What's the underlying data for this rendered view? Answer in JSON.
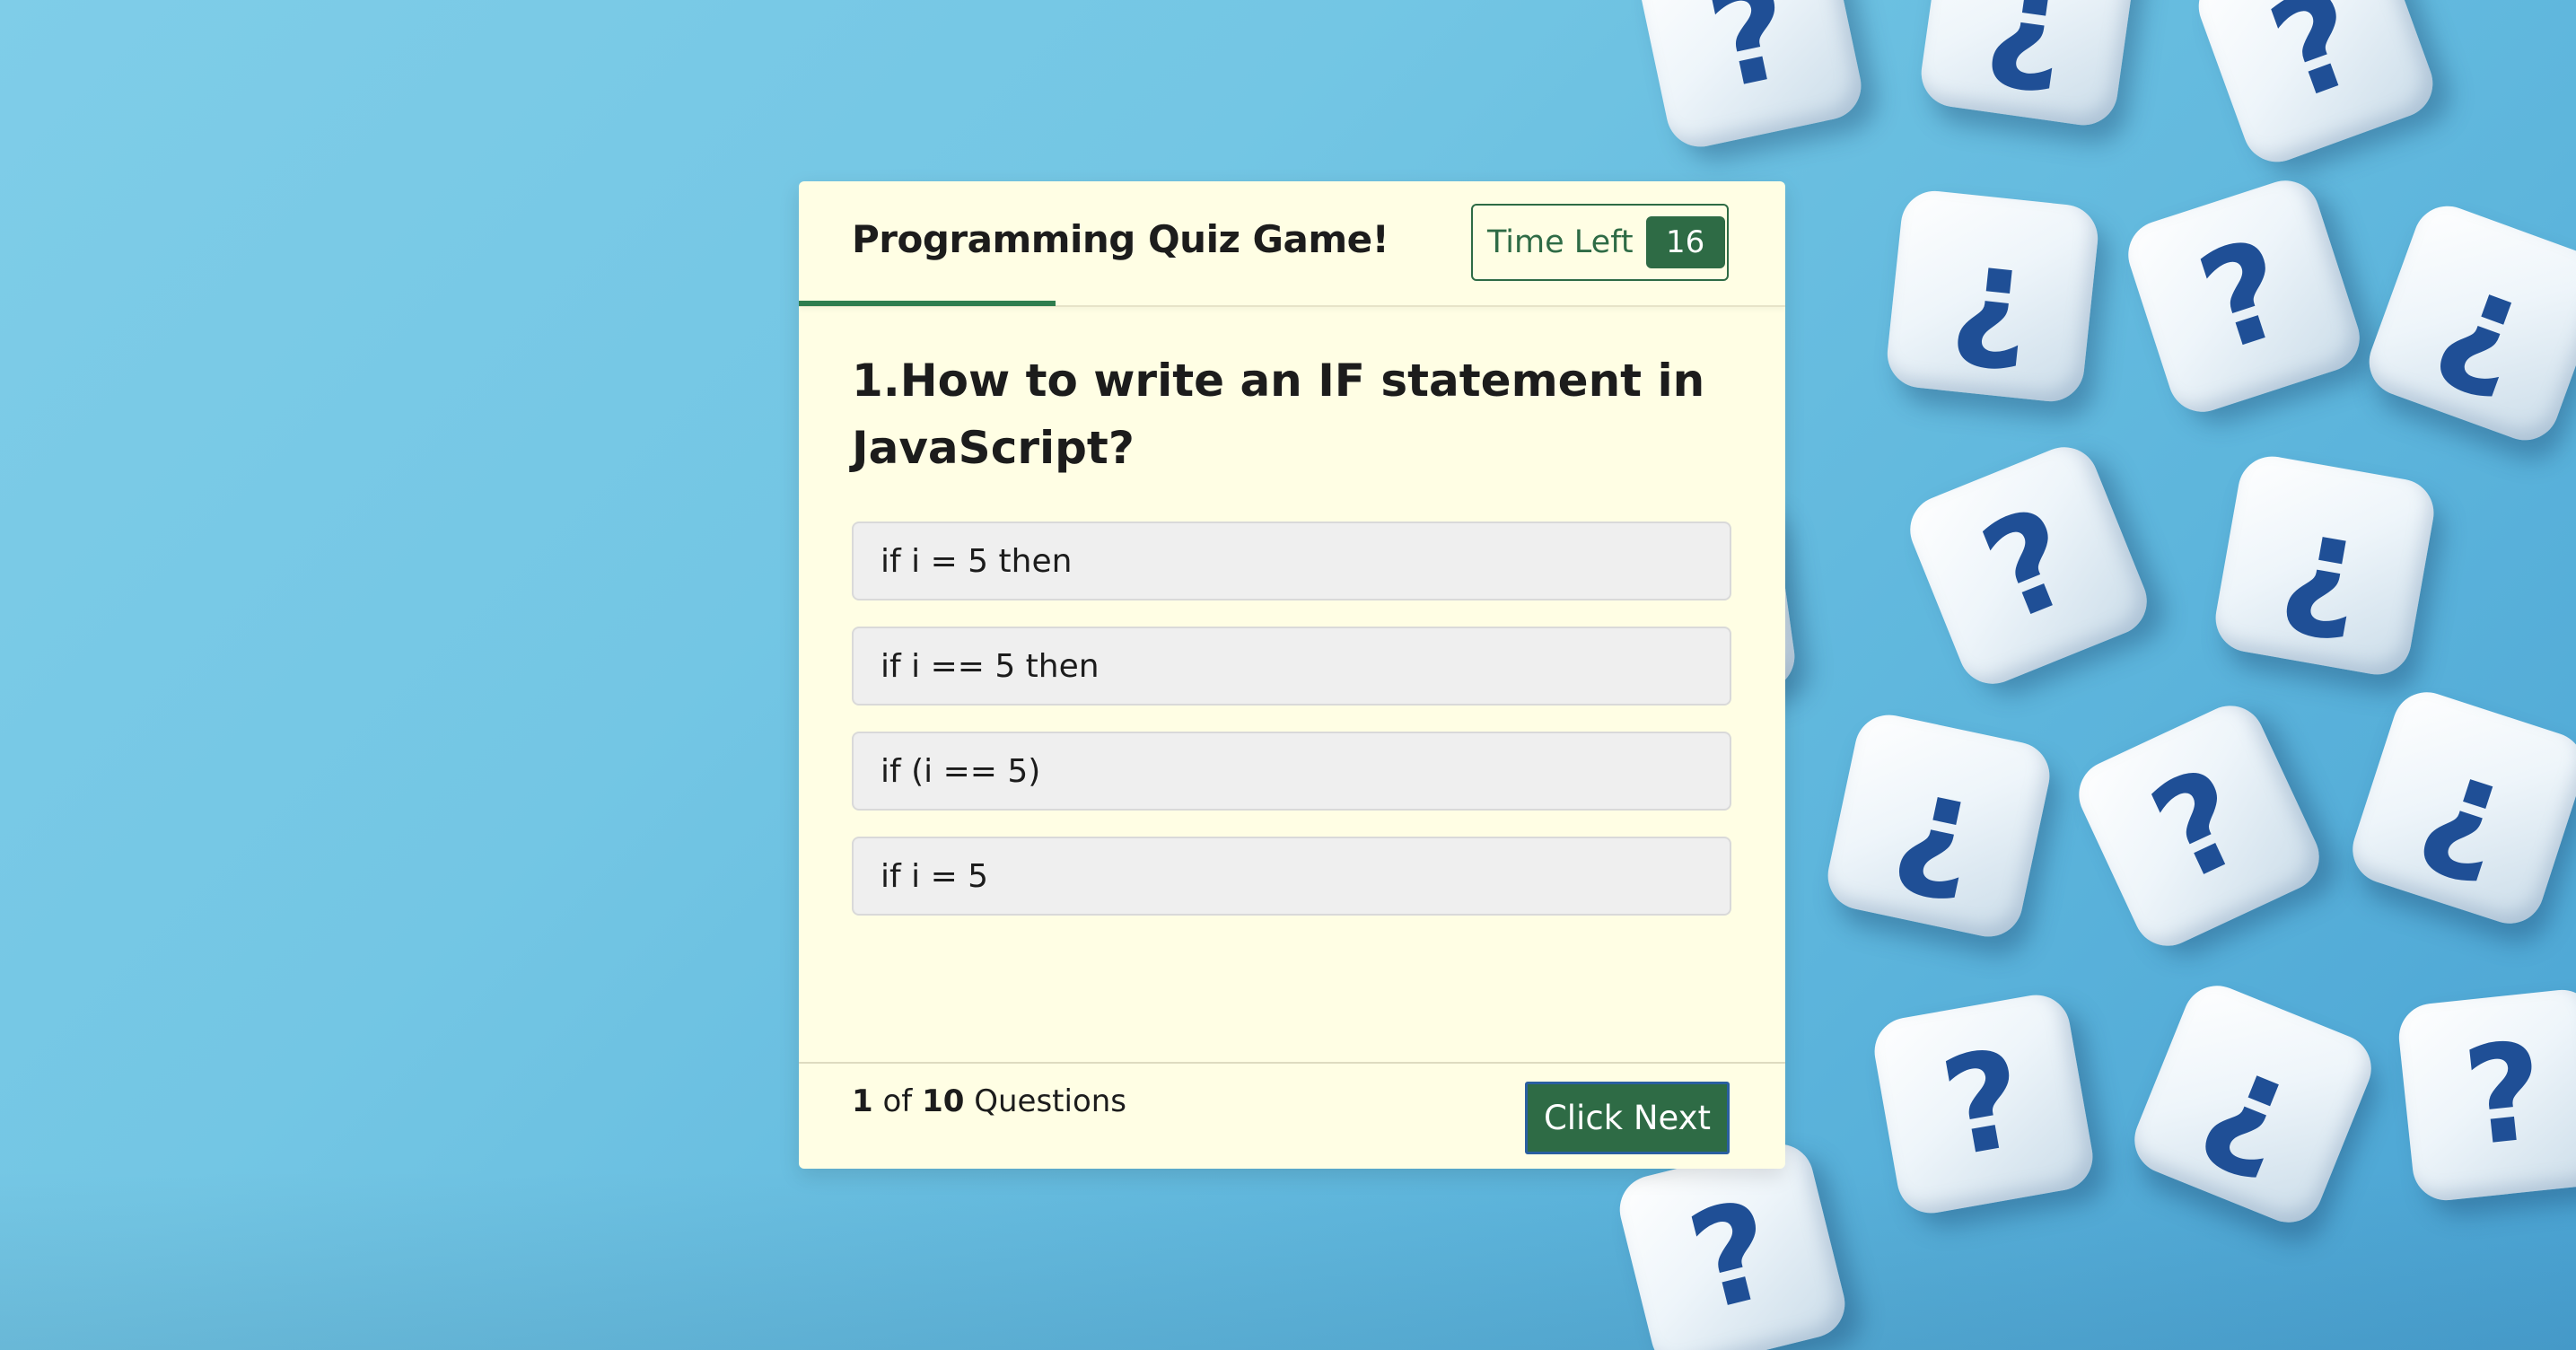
{
  "header": {
    "title": "Programming Quiz Game!",
    "timer_label": "Time Left",
    "timer_value": "16"
  },
  "quiz": {
    "question": "1.How to write an IF statement in JavaScript?",
    "progress_fraction": 0.26,
    "options": [
      {
        "label": "if i = 5 then"
      },
      {
        "label": "if i == 5 then"
      },
      {
        "label": "if (i == 5)"
      },
      {
        "label": "if i = 5"
      }
    ]
  },
  "footer": {
    "current_question": "1",
    "of_text": "of",
    "total_questions": "10",
    "questions_text": "Questions",
    "next_label": "Click Next"
  },
  "background": {
    "dice_glyphs": [
      "?",
      "¿",
      "?",
      "¿",
      "?",
      "¿",
      "?",
      "¿",
      "?",
      "¿",
      "?",
      "¿",
      "?",
      "¿",
      "?",
      "?"
    ]
  },
  "colors": {
    "accent_green": "#2e6b45",
    "card_background": "#fffee4",
    "page_background": "#73c6e4",
    "dice_glyph": "#1f4f96"
  }
}
